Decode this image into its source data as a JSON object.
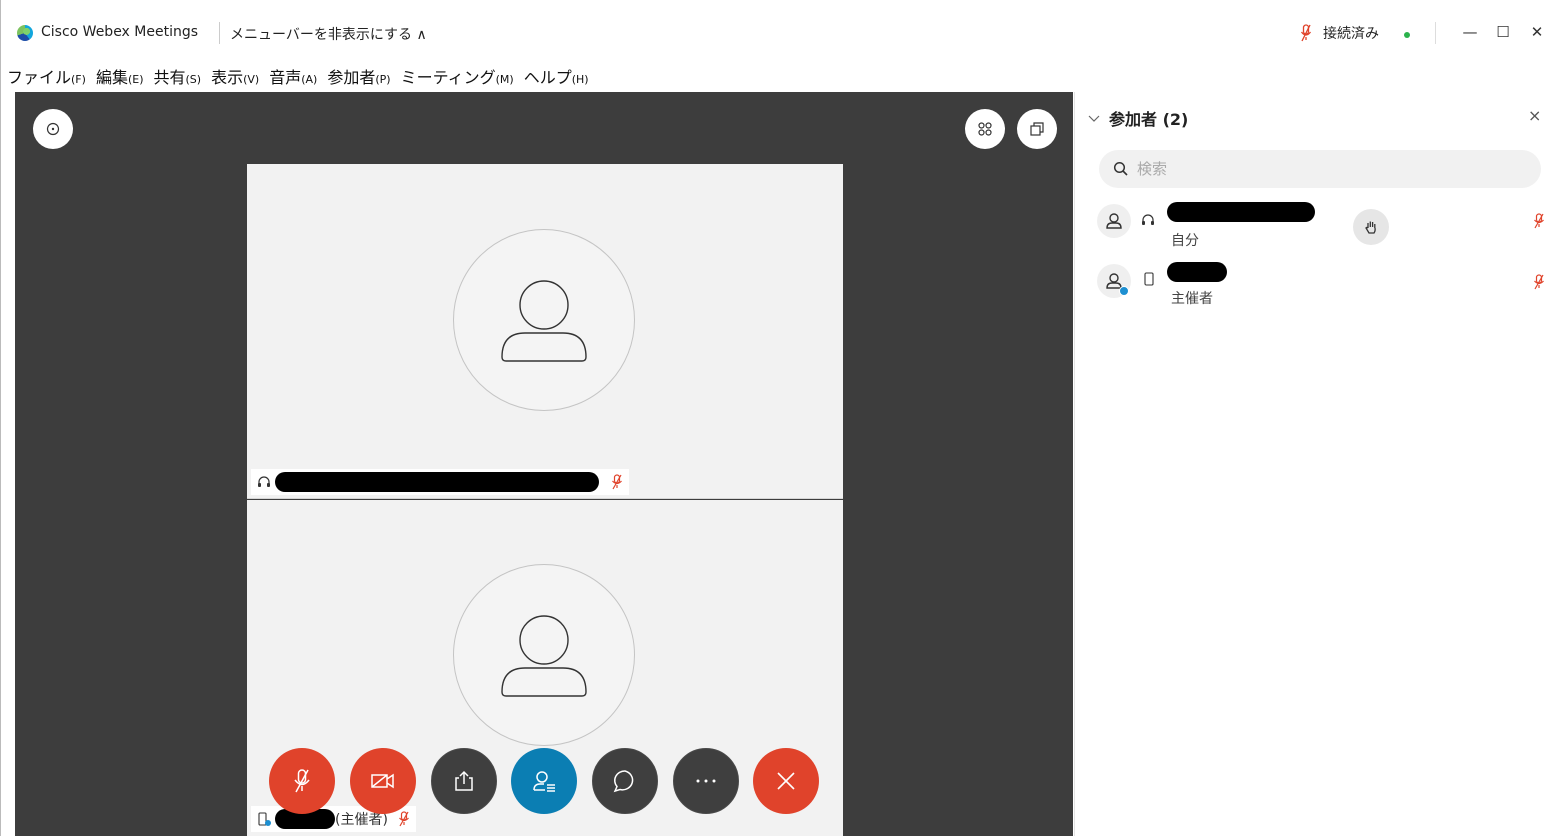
{
  "titlebar": {
    "app_title": "Cisco Webex Meetings",
    "hide_menu_label": "メニューバーを非表示にする ∧",
    "connection_status": "接続済み",
    "minimize": "—",
    "maximize": "☐",
    "close": "✕"
  },
  "menubar": {
    "items": [
      {
        "label": "ファイル",
        "key": "(F)"
      },
      {
        "label": "編集",
        "key": "(E)"
      },
      {
        "label": "共有",
        "key": "(S)"
      },
      {
        "label": "表示",
        "key": "(V)"
      },
      {
        "label": "音声",
        "key": "(A)"
      },
      {
        "label": "参加者",
        "key": "(P)"
      },
      {
        "label": "ミーティング",
        "key": "(M)"
      },
      {
        "label": "ヘルプ",
        "key": "(H)"
      }
    ]
  },
  "stage": {
    "tiles": [
      {
        "audio_icon": "headset-icon",
        "host_suffix": ""
      },
      {
        "audio_icon": "phone-icon",
        "host_suffix": "(主催者)"
      }
    ]
  },
  "controls": [
    {
      "name": "mute-button",
      "icon": "mic-off-icon",
      "color": "#e0432b"
    },
    {
      "name": "stop-video-button",
      "icon": "video-off-icon",
      "color": "#e0432b"
    },
    {
      "name": "share-button",
      "icon": "share-icon",
      "color": "#3f3f3f"
    },
    {
      "name": "participants-button",
      "icon": "participants-icon",
      "color": "#0b7eb3"
    },
    {
      "name": "chat-button",
      "icon": "chat-icon",
      "color": "#3f3f3f"
    },
    {
      "name": "more-button",
      "icon": "more-icon",
      "color": "#3f3f3f"
    },
    {
      "name": "leave-button",
      "icon": "close-icon",
      "color": "#e0432b"
    }
  ],
  "panel": {
    "title": "参加者 (2)",
    "close": "×",
    "search_placeholder": "検索",
    "participants": [
      {
        "sub": "自分",
        "audio_icon": "headset-icon"
      },
      {
        "sub": "主催者",
        "audio_icon": "phone-icon"
      }
    ]
  },
  "colors": {
    "stage_bg": "#3d3d3d",
    "accent_red": "#e0432b",
    "accent_blue": "#0b7eb3",
    "connected_green": "#2bb24c"
  }
}
